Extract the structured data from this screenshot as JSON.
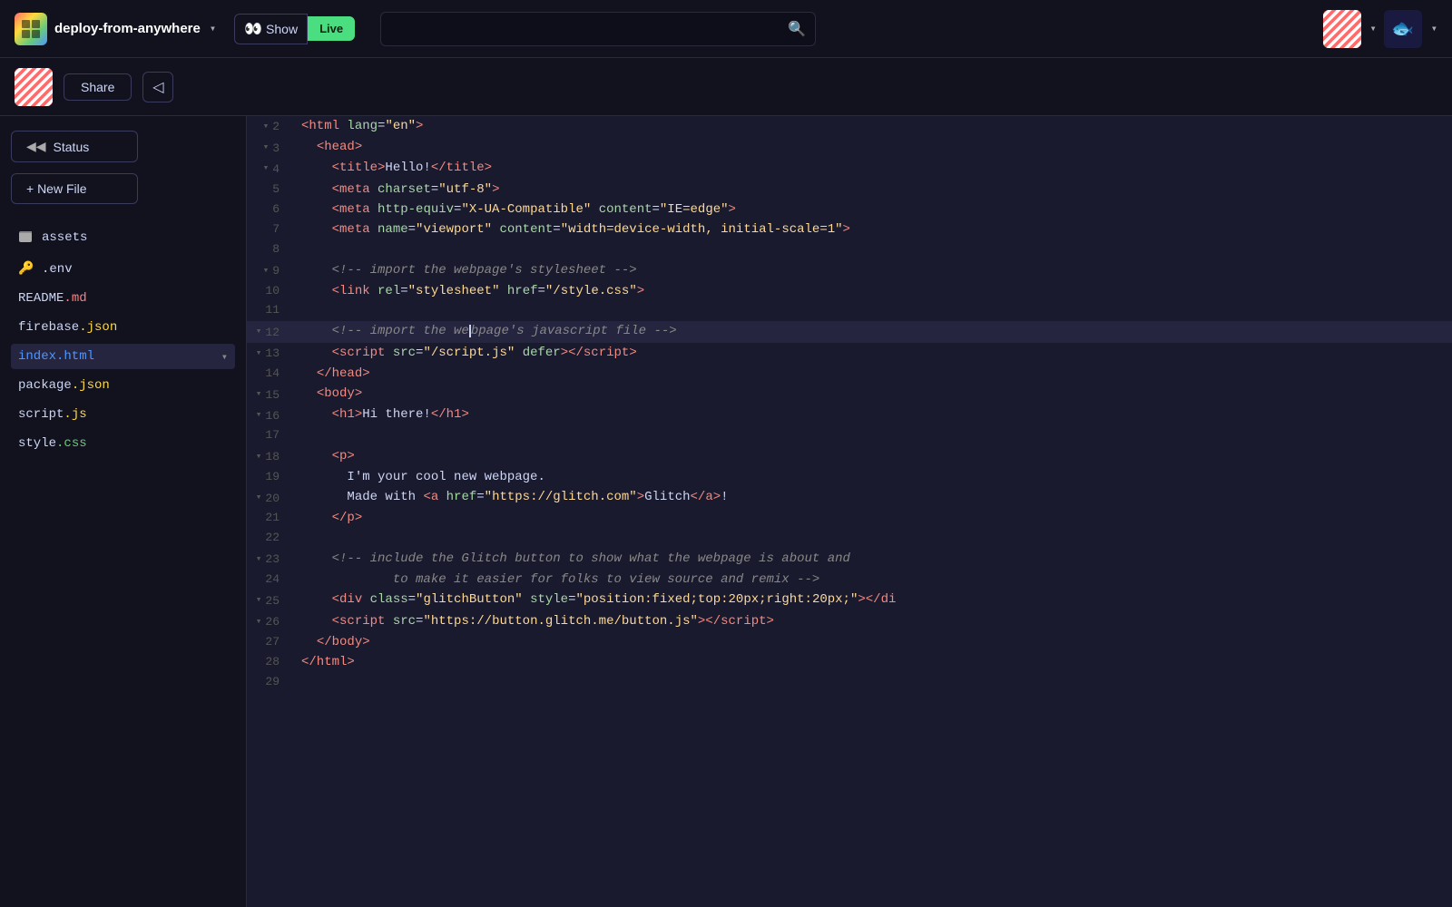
{
  "topnav": {
    "project_name": "deploy-from-anywhere",
    "show_label": "Show",
    "live_label": "Live",
    "search_placeholder": ""
  },
  "toolbar2": {
    "share_label": "Share"
  },
  "sidebar": {
    "status_label": "Status",
    "new_file_label": "+ New File",
    "items": [
      {
        "name": "assets",
        "type": "dir",
        "icon": "📁",
        "indent": 0
      },
      {
        "name": ".env",
        "type": "env",
        "icon": "🔑",
        "indent": 0
      },
      {
        "name": "README",
        "ext": ".md",
        "type": "md",
        "indent": 0
      },
      {
        "name": "firebase",
        "ext": ".json",
        "type": "json",
        "indent": 0
      },
      {
        "name": "index",
        "ext": ".html",
        "type": "html",
        "indent": 0,
        "active": true
      },
      {
        "name": "package",
        "ext": ".json",
        "type": "json",
        "indent": 0
      },
      {
        "name": "script",
        "ext": ".js",
        "type": "js",
        "indent": 0
      },
      {
        "name": "style",
        "ext": ".css",
        "type": "css",
        "indent": 0
      }
    ]
  },
  "editor": {
    "lines": [
      {
        "num": 2,
        "fold": true,
        "code": "&lt;html lang=\"en\"&gt;"
      },
      {
        "num": 3,
        "fold": true,
        "code": "  &lt;head&gt;"
      },
      {
        "num": 4,
        "fold": true,
        "code": "    &lt;title&gt;Hello!&lt;/title&gt;"
      },
      {
        "num": 5,
        "fold": false,
        "code": "    &lt;meta charset=\"utf-8\"&gt;"
      },
      {
        "num": 6,
        "fold": false,
        "code": "    &lt;meta http-equiv=\"X-UA-Compatible\" content=\"IE=edge\"&gt;"
      },
      {
        "num": 7,
        "fold": false,
        "code": "    &lt;meta name=\"viewport\" content=\"width=device-width, initial-scale=1\"&gt;"
      },
      {
        "num": 8,
        "fold": false,
        "code": ""
      },
      {
        "num": 9,
        "fold": true,
        "code": "    &lt;!-- import the webpage's stylesheet --&gt;"
      },
      {
        "num": 10,
        "fold": false,
        "code": "    &lt;link rel=\"stylesheet\" href=\"/style.css\"&gt;"
      },
      {
        "num": 11,
        "fold": false,
        "code": ""
      },
      {
        "num": 12,
        "fold": true,
        "code": "    &lt;!-- import the webpage's javascript file --&gt;",
        "highlighted": true
      },
      {
        "num": 13,
        "fold": true,
        "code": "    &lt;script src=\"/script.js\" defer&gt;&lt;/script&gt;"
      },
      {
        "num": 14,
        "fold": false,
        "code": "  &lt;/head&gt;"
      },
      {
        "num": 15,
        "fold": true,
        "code": "  &lt;body&gt;"
      },
      {
        "num": 16,
        "fold": true,
        "code": "    &lt;h1&gt;Hi there!&lt;/h1&gt;"
      },
      {
        "num": 17,
        "fold": false,
        "code": ""
      },
      {
        "num": 18,
        "fold": true,
        "code": "    &lt;p&gt;"
      },
      {
        "num": 19,
        "fold": false,
        "code": "      I'm your cool new webpage."
      },
      {
        "num": 20,
        "fold": true,
        "code": "      Made with &lt;a href=\"https://glitch.com\"&gt;Glitch&lt;/a&gt;!"
      },
      {
        "num": 21,
        "fold": false,
        "code": "    &lt;/p&gt;"
      },
      {
        "num": 22,
        "fold": false,
        "code": ""
      },
      {
        "num": 23,
        "fold": true,
        "code": "    &lt;!-- include the Glitch button to show what the webpage is about and"
      },
      {
        "num": 24,
        "fold": false,
        "code": "            to make it easier for folks to view source and remix --&gt;"
      },
      {
        "num": 25,
        "fold": true,
        "code": "    &lt;div class=\"glitchButton\" style=\"position:fixed;top:20px;right:20px;\"&gt;&lt;/di"
      },
      {
        "num": 26,
        "fold": true,
        "code": "    &lt;script src=\"https://button.glitch.me/button.js\"&gt;&lt;/script&gt;"
      },
      {
        "num": 27,
        "fold": false,
        "code": "  &lt;/body&gt;"
      },
      {
        "num": 28,
        "fold": false,
        "code": "&lt;/html&gt;"
      },
      {
        "num": 29,
        "fold": false,
        "code": ""
      }
    ]
  }
}
